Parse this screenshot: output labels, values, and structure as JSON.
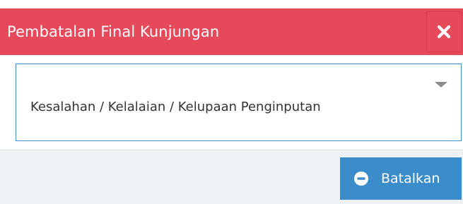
{
  "dialog": {
    "title": "Pembatalan Final Kunjungan",
    "close_icon": "close-icon",
    "header_color": "#e5495a"
  },
  "reason_select": {
    "selected_value": "Kesalahan / Kelalaian / Kelupaan Penginputan",
    "caret_icon": "caret-down-icon",
    "border_color": "#3e8ed0"
  },
  "footer": {
    "cancel_button": {
      "label": "Batalkan",
      "icon": "minus-circle-icon",
      "color": "#3a8ccb"
    }
  }
}
